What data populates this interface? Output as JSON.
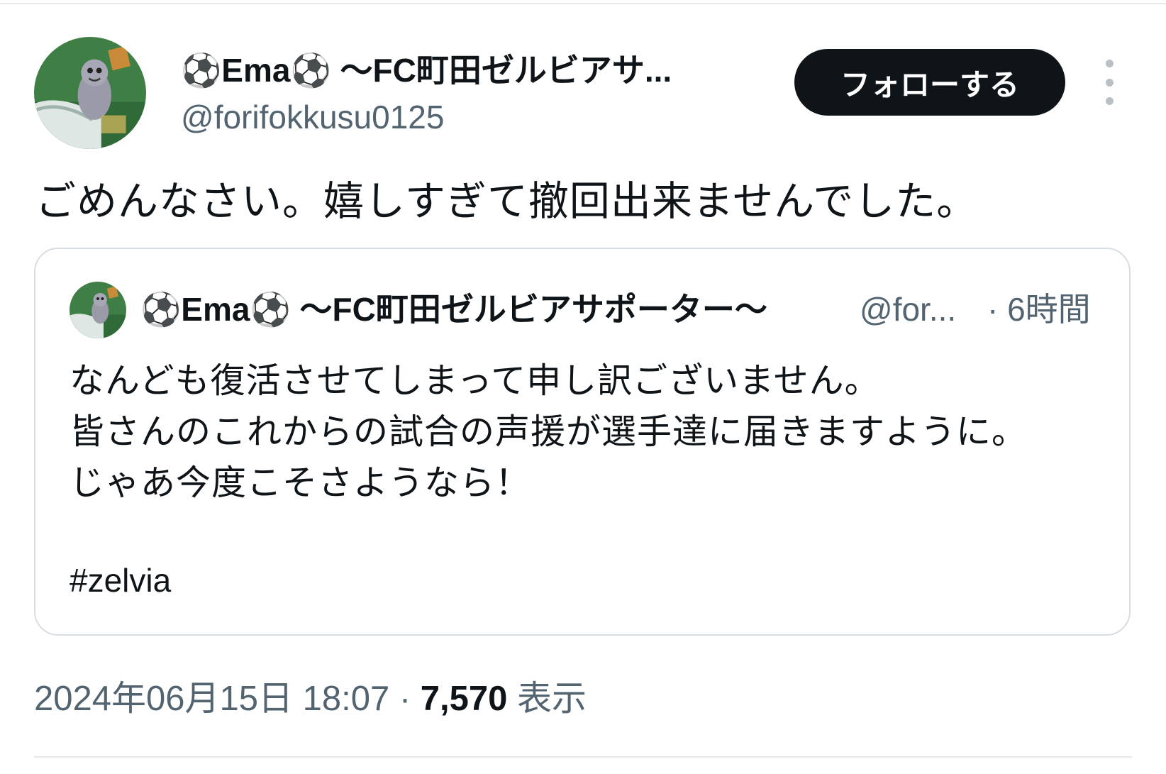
{
  "tweet": {
    "author": {
      "display_name": "⚽Ema⚽ 〜FC町田ゼルビアサ...",
      "handle": "@forifokkusu0125",
      "avatar_icon": "mascot-avatar-icon"
    },
    "follow_label": "フォローする",
    "more_icon": "more-options-icon",
    "text": "ごめんなさい。嬉しすぎて撤回出来ませんでした。",
    "quoted": {
      "display_name": "⚽Ema⚽ 〜FC町田ゼルビアサポーター〜",
      "handle": "@for...",
      "time": "· 6時間",
      "lines": [
        "なんども復活させてしまって申し訳ございません。",
        "皆さんのこれからの試合の声援が選手達に届きますように。",
        "じゃあ今度こそさようなら！"
      ],
      "hashtag": "#zelvia"
    },
    "timestamp": "2024年06月15日 18:07",
    "separator": " · ",
    "views": "7,570",
    "views_label": " 表示"
  },
  "colors": {
    "text_primary": "#0f1419",
    "text_secondary": "#536471",
    "border": "#d7dde1",
    "follow_button_bg": "#0f1419"
  }
}
